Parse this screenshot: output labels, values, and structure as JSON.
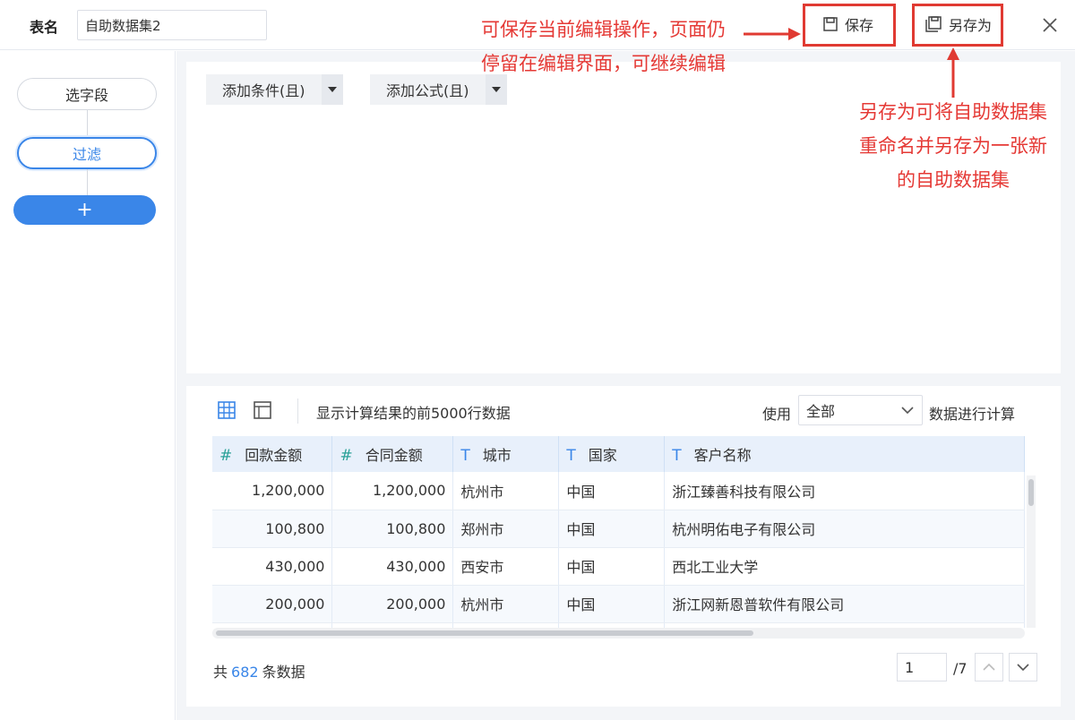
{
  "header": {
    "table_name_label": "表名",
    "table_name_value": "自助数据集2",
    "save_label": "保存",
    "save_as_label": "另存为"
  },
  "annotations": {
    "save_note_line1": "可保存当前编辑操作，页面仍",
    "save_note_line2": "停留在编辑界面，可继续编辑",
    "save_as_note_line1": "另存为可将自助数据集",
    "save_as_note_line2": "重命名并另存为一张新",
    "save_as_note_line3": "的自助数据集",
    "color": "#e53935"
  },
  "steps": {
    "items": [
      {
        "label": "选字段"
      },
      {
        "label": "过滤"
      }
    ],
    "add_label": "+"
  },
  "filter": {
    "add_condition": "添加条件(且)",
    "add_formula": "添加公式(且)"
  },
  "result": {
    "hint": "显示计算结果的前5000行数据",
    "use_label": "使用",
    "use_value": "全部",
    "use_after": "数据进行计算",
    "columns": [
      {
        "type": "#",
        "name": "回款金额"
      },
      {
        "type": "#",
        "name": "合同金额"
      },
      {
        "type": "T",
        "name": "城市"
      },
      {
        "type": "T",
        "name": "国家"
      },
      {
        "type": "T",
        "name": "客户名称"
      }
    ],
    "rows": [
      [
        "1,200,000",
        "1,200,000",
        "杭州市",
        "中国",
        "浙江臻善科技有限公司"
      ],
      [
        "100,800",
        "100,800",
        "郑州市",
        "中国",
        "杭州明佑电子有限公司"
      ],
      [
        "430,000",
        "430,000",
        "西安市",
        "中国",
        "西北工业大学"
      ],
      [
        "200,000",
        "200,000",
        "杭州市",
        "中国",
        "浙江网新恩普软件有限公司"
      ]
    ],
    "total_prefix": "共",
    "total_count": "682",
    "total_suffix": "条数据",
    "page_current": "1",
    "page_total": "/7"
  },
  "colors": {
    "accent": "#3a86e8",
    "annotation_red": "#e03a32",
    "header_bg": "#e8f0fb"
  },
  "icons": [
    "save-icon",
    "save-as-icon",
    "close-icon",
    "grid-view-icon",
    "layout-view-icon",
    "chevron-down-icon",
    "chevron-up-icon"
  ]
}
